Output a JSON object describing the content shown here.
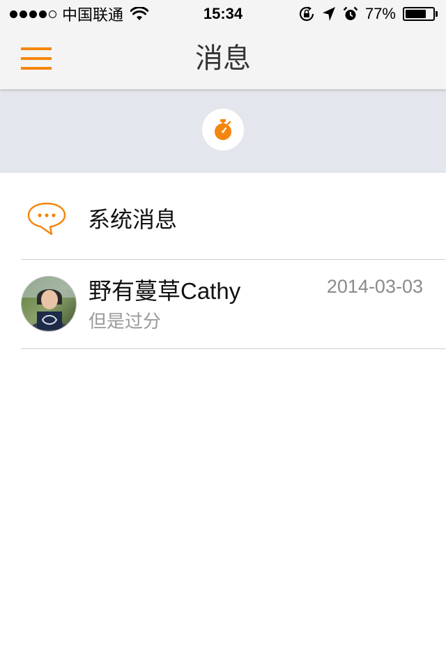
{
  "status_bar": {
    "carrier": "中国联通",
    "time": "15:34",
    "battery_percent": "77%",
    "battery_level": 0.77,
    "signal_bars_filled": 4,
    "signal_bars_total": 5,
    "icons": [
      "wifi-icon",
      "rotation-lock-icon",
      "location-arrow-icon",
      "alarm-clock-icon",
      "battery-icon"
    ]
  },
  "nav": {
    "title": "消息",
    "menu_icon": "hamburger-menu-icon"
  },
  "banner": {
    "icon": "stopwatch-icon"
  },
  "messages": {
    "system": {
      "label": "系统消息",
      "icon": "speech-bubble-icon"
    },
    "chats": [
      {
        "name": "野有蔓草Cathy",
        "date": "2014-03-03",
        "preview": "但是过分",
        "avatar": "user-avatar"
      }
    ]
  },
  "colors": {
    "accent": "#f5860d",
    "bar_background": "#f4f4f4",
    "banner_background": "#e3e6ec",
    "secondary_text": "#8a8a8a",
    "divider": "#cfcfcf"
  }
}
